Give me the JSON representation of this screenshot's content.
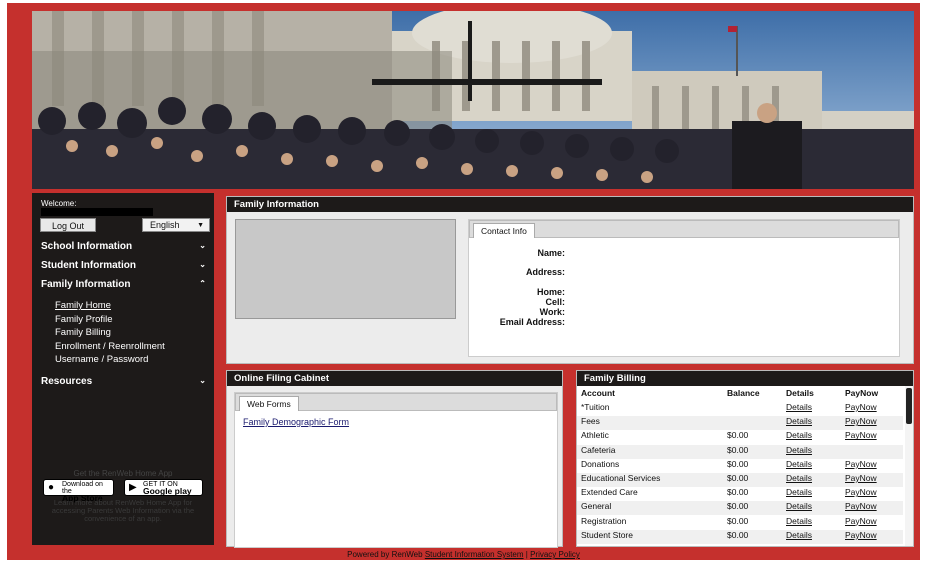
{
  "sidebar": {
    "welcome_label": "Welcome:",
    "logout_label": "Log Out",
    "language_selected": "English",
    "sections": [
      {
        "label": "School Information",
        "icon": "chevron-down-icon"
      },
      {
        "label": "Student Information",
        "icon": "chevron-down-icon"
      },
      {
        "label": "Family Information",
        "icon": "chevron-up-icon"
      },
      {
        "label": "Resources",
        "icon": "chevron-down-icon"
      }
    ],
    "family_items": [
      "Family Home",
      "Family Profile",
      "Family Billing",
      "Enrollment / Reenrollment",
      "Username / Password"
    ],
    "app_promo_title": "Get the RenWeb Home App",
    "app_store_top": "Download on the",
    "app_store_label": "App Store",
    "google_play_top": "GET IT ON",
    "google_play_label": "Google play",
    "promo_text": "Learn more about RenWeb Home App for accessing Parents Web Information via the convenience of an app."
  },
  "family_info": {
    "title": "Family Information",
    "tab_label": "Contact Info",
    "labels": {
      "name": "Name:",
      "address": "Address:",
      "home": "Home:",
      "cell": "Cell:",
      "work": "Work:",
      "email": "Email Address:"
    }
  },
  "filing_cabinet": {
    "title": "Online Filing Cabinet",
    "tab_label": "Web Forms",
    "forms": [
      "Family Demographic Form"
    ]
  },
  "billing": {
    "title": "Family Billing",
    "headers": {
      "account": "Account",
      "balance": "Balance",
      "details": "Details",
      "paynow": "PayNow"
    },
    "rows": [
      {
        "account": "*Tuition",
        "balance": "",
        "details": "Details",
        "paynow": "PayNow"
      },
      {
        "account": "Fees",
        "balance": "",
        "details": "Details",
        "paynow": "PayNow"
      },
      {
        "account": "Athletic",
        "balance": "$0.00",
        "details": "Details",
        "paynow": "PayNow"
      },
      {
        "account": "Cafeteria",
        "balance": "$0.00",
        "details": "Details",
        "paynow": ""
      },
      {
        "account": "Donations",
        "balance": "$0.00",
        "details": "Details",
        "paynow": "PayNow"
      },
      {
        "account": "Educational Services",
        "balance": "$0.00",
        "details": "Details",
        "paynow": "PayNow"
      },
      {
        "account": "Extended Care",
        "balance": "$0.00",
        "details": "Details",
        "paynow": "PayNow"
      },
      {
        "account": "General",
        "balance": "$0.00",
        "details": "Details",
        "paynow": "PayNow"
      },
      {
        "account": "Registration",
        "balance": "$0.00",
        "details": "Details",
        "paynow": "PayNow"
      },
      {
        "account": "Student Store",
        "balance": "$0.00",
        "details": "Details",
        "paynow": "PayNow"
      }
    ]
  },
  "footer": {
    "prefix": "Powered by RenWeb",
    "sis_link": "Student Information System",
    "separator": "|",
    "privacy_link": "Privacy Policy"
  },
  "colors": {
    "frame": "#c5302d",
    "sidebar": "#1d1a19",
    "panel_header": "#1d1a19"
  }
}
